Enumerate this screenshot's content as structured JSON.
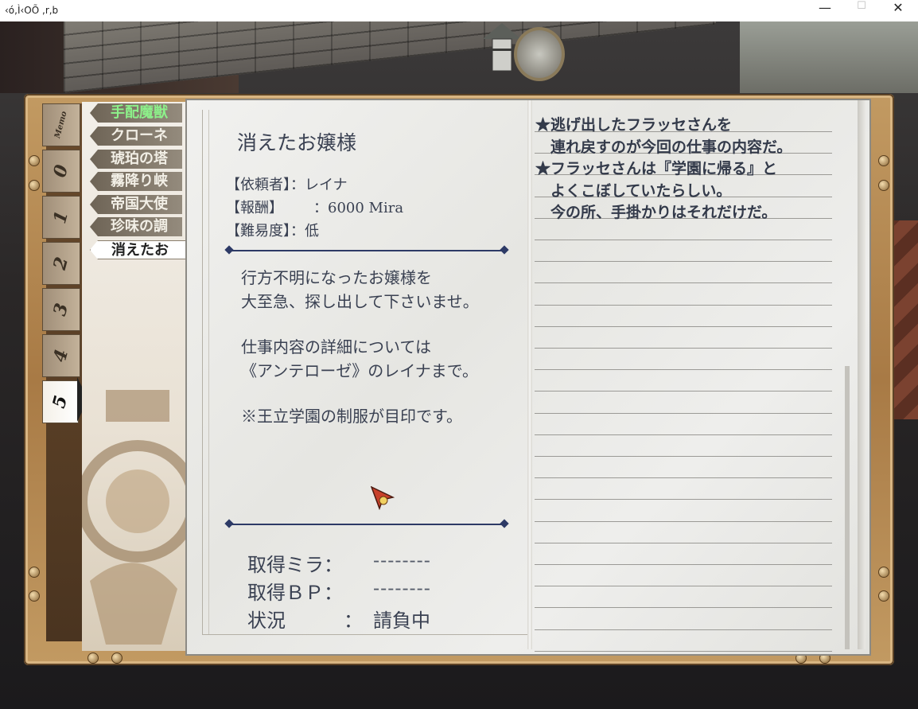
{
  "window": {
    "title": "‹ó,Ì‹OÕ ,r,b",
    "minimize_glyph": "—",
    "maximize_glyph": "☐",
    "close_glyph": "✕"
  },
  "tabs": [
    {
      "label": "Memo"
    },
    {
      "label": "0"
    },
    {
      "label": "1"
    },
    {
      "label": "2"
    },
    {
      "label": "3"
    },
    {
      "label": "4"
    },
    {
      "label": "5",
      "active": true
    }
  ],
  "quest_list": [
    {
      "label": "手配魔獣"
    },
    {
      "label": "クローネ"
    },
    {
      "label": "琥珀の塔"
    },
    {
      "label": "霧降り峡"
    },
    {
      "label": "帝国大使"
    },
    {
      "label": "珍味の調"
    },
    {
      "label": "消えたお",
      "active": true
    }
  ],
  "quest": {
    "title": "消えたお嬢様",
    "client_label": "【依頼者】：レイナ",
    "reward_label": "【報酬】",
    "reward_value": "：6000 Mira",
    "difficulty_label": "【難易度】：低",
    "description": [
      "行方不明になったお嬢様を",
      "大至急、探し出して下さいませ。",
      "仕事内容の詳細については",
      "《アンテローゼ》のレイナまで。",
      "※王立学園の制服が目印です。"
    ],
    "earned_mira_label": "取得ミラ：",
    "earned_mira_value": "--------",
    "earned_bp_label": "取得ＢＰ：",
    "earned_bp_value": "--------",
    "status_label": "状況",
    "status_colon": "：",
    "status_value": "請負中"
  },
  "notes": [
    "★逃げ出したフラッセさんを",
    "　連れ戻すのが今回の仕事の内容だ。",
    "★フラッセさんは『学園に帰る』と",
    "　よくこぼしていたらしい。",
    "　今の所、手掛かりはそれだけだ。"
  ],
  "icons": [
    "pointer-cursor-icon",
    "emblem-icon",
    "lamp-icon"
  ]
}
